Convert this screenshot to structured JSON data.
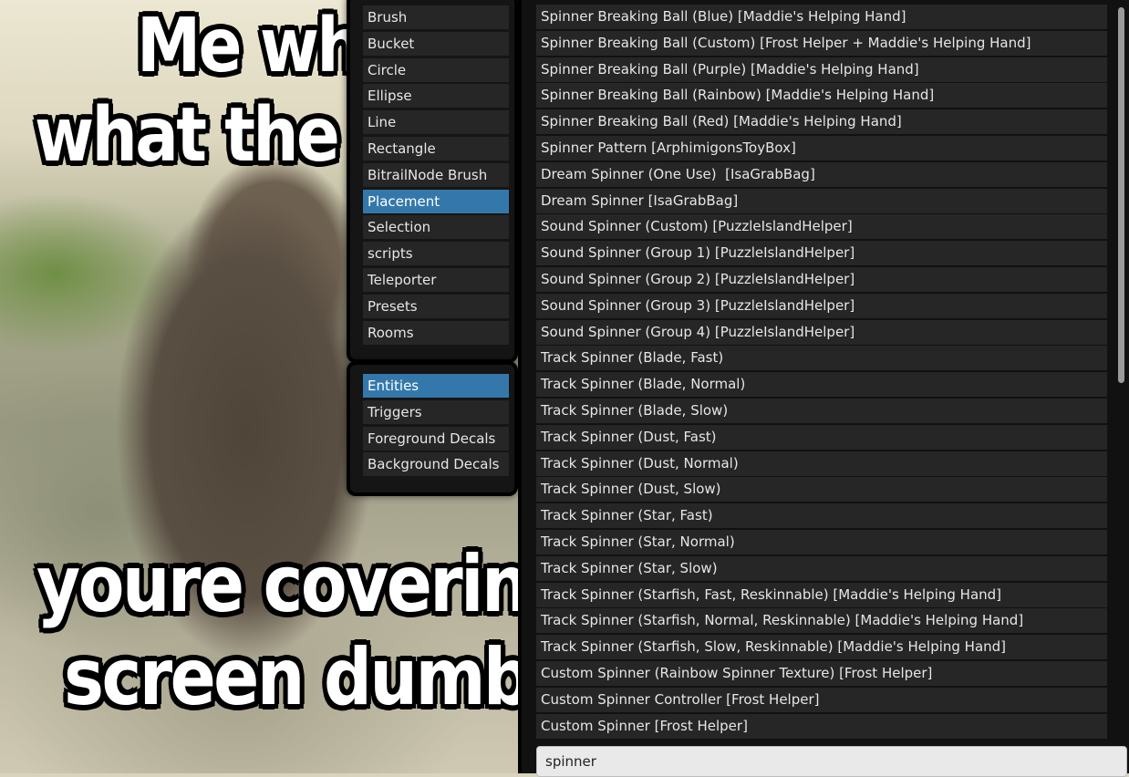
{
  "meme": {
    "top_line_1": "Me wh",
    "top_line_2": "what the",
    "bottom_line_1": "youre coverin",
    "bottom_line_2": "screen dumb"
  },
  "tools": [
    {
      "label": "Brush",
      "selected": false
    },
    {
      "label": "Bucket",
      "selected": false
    },
    {
      "label": "Circle",
      "selected": false
    },
    {
      "label": "Ellipse",
      "selected": false
    },
    {
      "label": "Line",
      "selected": false
    },
    {
      "label": "Rectangle",
      "selected": false
    },
    {
      "label": "BitrailNode Brush",
      "selected": false
    },
    {
      "label": "Placement",
      "selected": true
    },
    {
      "label": "Selection",
      "selected": false
    },
    {
      "label": "scripts",
      "selected": false
    },
    {
      "label": "Teleporter",
      "selected": false
    },
    {
      "label": "Presets",
      "selected": false
    },
    {
      "label": "Rooms",
      "selected": false
    }
  ],
  "layers": [
    {
      "label": "Entities",
      "selected": true
    },
    {
      "label": "Triggers",
      "selected": false
    },
    {
      "label": "Foreground Decals",
      "selected": false
    },
    {
      "label": "Background Decals",
      "selected": false
    }
  ],
  "entities": [
    "Spinner Breaking Ball (Blue) [Maddie's Helping Hand]",
    "Spinner Breaking Ball (Custom) [Frost Helper + Maddie's Helping Hand]",
    "Spinner Breaking Ball (Purple) [Maddie's Helping Hand]",
    "Spinner Breaking Ball (Rainbow) [Maddie's Helping Hand]",
    "Spinner Breaking Ball (Red) [Maddie's Helping Hand]",
    "Spinner Pattern [ArphimigonsToyBox]",
    "Dream Spinner (One Use)  [IsaGrabBag]",
    "Dream Spinner [IsaGrabBag]",
    "Sound Spinner (Custom) [PuzzleIslandHelper]",
    "Sound Spinner (Group 1) [PuzzleIslandHelper]",
    "Sound Spinner (Group 2) [PuzzleIslandHelper]",
    "Sound Spinner (Group 3) [PuzzleIslandHelper]",
    "Sound Spinner (Group 4) [PuzzleIslandHelper]",
    "Track Spinner (Blade, Fast)",
    "Track Spinner (Blade, Normal)",
    "Track Spinner (Blade, Slow)",
    "Track Spinner (Dust, Fast)",
    "Track Spinner (Dust, Normal)",
    "Track Spinner (Dust, Slow)",
    "Track Spinner (Star, Fast)",
    "Track Spinner (Star, Normal)",
    "Track Spinner (Star, Slow)",
    "Track Spinner (Starfish, Fast, Reskinnable) [Maddie's Helping Hand]",
    "Track Spinner (Starfish, Normal, Reskinnable) [Maddie's Helping Hand]",
    "Track Spinner (Starfish, Slow, Reskinnable) [Maddie's Helping Hand]",
    "Custom Spinner (Rainbow Spinner Texture) [Frost Helper]",
    "Custom Spinner Controller [Frost Helper]",
    "Custom Spinner [Frost Helper]"
  ],
  "search": {
    "value": "spinner"
  },
  "colors": {
    "selected": "#3478ab",
    "row_bg": "#262626",
    "panel_bg": "#151515"
  }
}
